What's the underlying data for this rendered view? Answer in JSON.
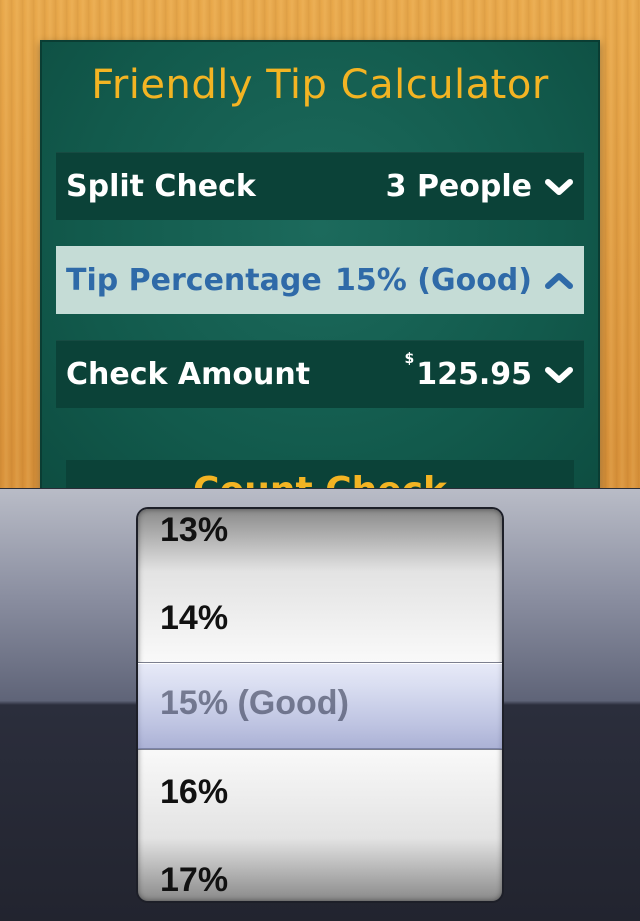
{
  "app": {
    "title": "Friendly Tip Calculator"
  },
  "rows": [
    {
      "label": "Split Check",
      "value": "3 People",
      "state": "collapsed",
      "chevron": "chevron-down-icon"
    },
    {
      "label": "Tip Percentage",
      "value": "15% (Good)",
      "state": "expanded",
      "chevron": "chevron-up-icon"
    },
    {
      "label": "Check Amount",
      "currency": "$",
      "value": "125.95",
      "state": "collapsed",
      "chevron": "chevron-down-icon"
    }
  ],
  "next_button": {
    "label": "Count Check"
  },
  "picker": {
    "items": [
      "13%",
      "14%",
      "15% (Good)",
      "16%",
      "17%"
    ],
    "selected": "15% (Good)"
  },
  "colors": {
    "board": "#125a4c",
    "row": "#0b4238",
    "active_row": "#c5dcd6",
    "active_text": "#2f6aa8",
    "title": "#f3b423"
  }
}
